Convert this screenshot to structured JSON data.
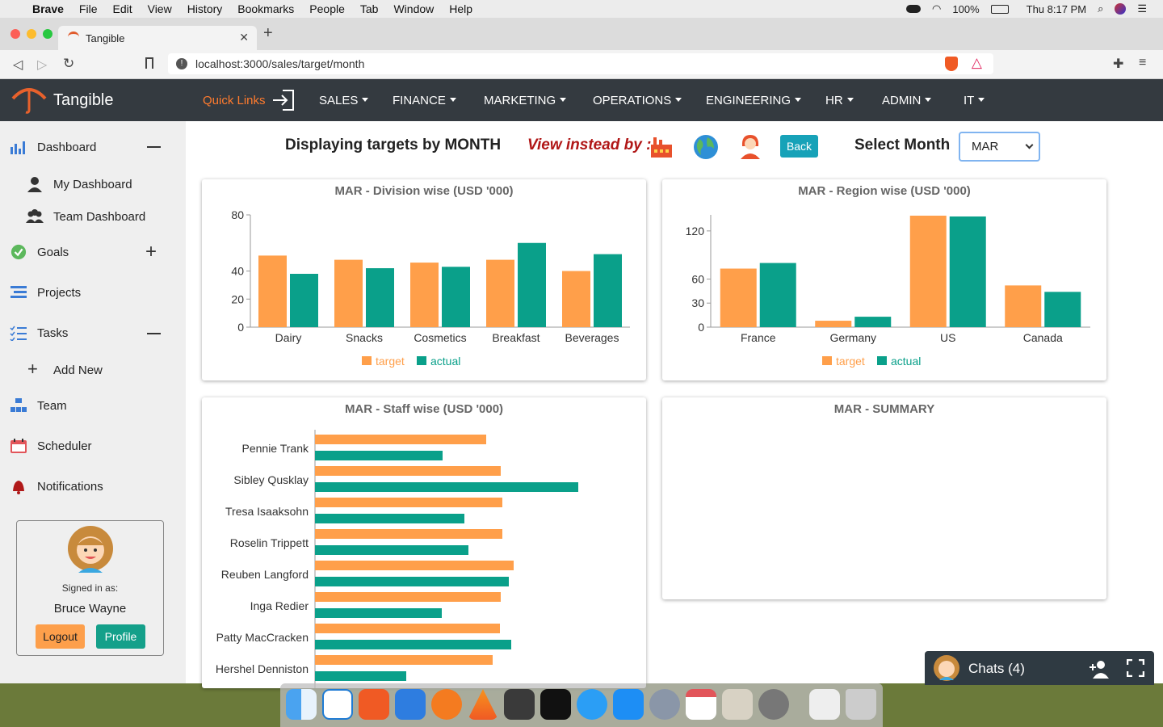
{
  "menubar": {
    "app": "Brave",
    "items": [
      "File",
      "Edit",
      "View",
      "History",
      "Bookmarks",
      "People",
      "Tab",
      "Window",
      "Help"
    ],
    "battery": "100%",
    "clock": "Thu 8:17 PM"
  },
  "browser": {
    "tab_title": "Tangible",
    "url": "localhost:3000/sales/target/month"
  },
  "navbar": {
    "brand": "Tangible",
    "quick_links": "Quick Links",
    "items": [
      "SALES",
      "FINANCE",
      "MARKETING",
      "OPERATIONS",
      "ENGINEERING",
      "HR",
      "ADMIN",
      "IT"
    ]
  },
  "sidebar": {
    "dashboard": "Dashboard",
    "my_dashboard": "My Dashboard",
    "team_dashboard": "Team Dashboard",
    "goals": "Goals",
    "projects": "Projects",
    "tasks": "Tasks",
    "add_new": "Add New",
    "team": "Team",
    "scheduler": "Scheduler",
    "notifications": "Notifications",
    "signed_in_as": "Signed in as:",
    "user_name": "Bruce Wayne",
    "logout": "Logout",
    "profile": "Profile"
  },
  "toolbar": {
    "heading": "Displaying targets by MONTH",
    "view_instead": "View instead by :",
    "back": "Back",
    "select_label": "Select Month",
    "month_value": "MAR"
  },
  "colors": {
    "target": "#ff9f4a",
    "actual": "#0aa08a",
    "brand_orange": "#ff7b2e",
    "navbar": "#343a40"
  },
  "chat": {
    "label": "Chats (4)"
  },
  "summary": {
    "title": "MAR - SUMMARY"
  },
  "chart_data": [
    {
      "type": "bar",
      "title": "MAR - Division wise (USD '000)",
      "categories": [
        "Dairy",
        "Snacks",
        "Cosmetics",
        "Breakfast",
        "Beverages"
      ],
      "series": [
        {
          "name": "target",
          "values": [
            51,
            48,
            46,
            48,
            40
          ]
        },
        {
          "name": "actual",
          "values": [
            38,
            42,
            43,
            60,
            52
          ]
        }
      ],
      "yticks": [
        "0",
        "20",
        "40",
        "80"
      ],
      "ylim": [
        0,
        80
      ],
      "legend": "bottom"
    },
    {
      "type": "bar",
      "title": "MAR - Region wise (USD '000)",
      "categories": [
        "France",
        "Germany",
        "US",
        "Canada"
      ],
      "series": [
        {
          "name": "target",
          "values": [
            73,
            8,
            139,
            52
          ]
        },
        {
          "name": "actual",
          "values": [
            80,
            13,
            138,
            44
          ]
        }
      ],
      "yticks": [
        "0",
        "30",
        "60",
        "120"
      ],
      "ylim": [
        0,
        140
      ],
      "legend": "bottom"
    },
    {
      "type": "bar",
      "orientation": "horizontal",
      "title": "MAR - Staff wise (USD '000)",
      "categories": [
        "Pennie Trank",
        "Sibley Qusklay",
        "Tresa Isaaksohn",
        "Roselin Trippett",
        "Reuben Langford",
        "Inga Redier",
        "Patty MacCracken",
        "Hershel Denniston"
      ],
      "series": [
        {
          "name": "target",
          "values": [
            212,
            230,
            232,
            232,
            246,
            230,
            229,
            220
          ]
        },
        {
          "name": "actual",
          "values": [
            158,
            326,
            185,
            190,
            240,
            157,
            243,
            113
          ]
        }
      ]
    }
  ]
}
